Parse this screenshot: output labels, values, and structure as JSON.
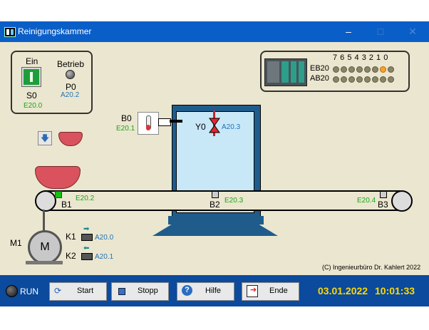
{
  "window": {
    "title": "Reinigungskammer",
    "minimize": "–",
    "maximize": "□",
    "close": "✕"
  },
  "control_panel": {
    "ein_label": "Ein",
    "betrieb_label": "Betrieb",
    "s0_label": "S0",
    "s0_addr": "E20.0",
    "p0_label": "P0",
    "p0_addr": "A20.2"
  },
  "plc": {
    "bit_header": "7 6 5 4 3 2 1 0",
    "eb_label": "EB20",
    "ab_label": "AB20",
    "eb_leds": [
      false,
      false,
      false,
      false,
      false,
      false,
      true,
      false
    ],
    "ab_leds": [
      false,
      false,
      false,
      false,
      false,
      false,
      false,
      false
    ],
    "led_on_color": "#f7a12c"
  },
  "sensors": {
    "b0_label": "B0",
    "b0_addr": "E20.1",
    "y0_label": "Y0",
    "y0_addr": "A20.3",
    "b1_label": "B1",
    "b1_addr": "E20.2",
    "b2_label": "B2",
    "b2_addr": "E20.3",
    "b3_label": "B3",
    "b3_addr": "E20.4"
  },
  "motor": {
    "m1_label": "M1",
    "m_letter": "M",
    "k1_label": "K1",
    "k1_addr": "A20.0",
    "k2_label": "K2",
    "k2_addr": "A20.1"
  },
  "copyright": "(C) Ingenieurbüro Dr. Kahlert 2022",
  "status": {
    "run_label": "RUN",
    "start_label": "Start",
    "stop_label": "Stopp",
    "help_label": "Hilfe",
    "end_label": "Ende",
    "date": "03.01.2022",
    "time": "10:01:33"
  },
  "colors": {
    "titlebar": "#0a5ec7",
    "statusbar": "#0b4a9c",
    "chamber": "#1f5c8c",
    "water": "#c8e8f8"
  }
}
